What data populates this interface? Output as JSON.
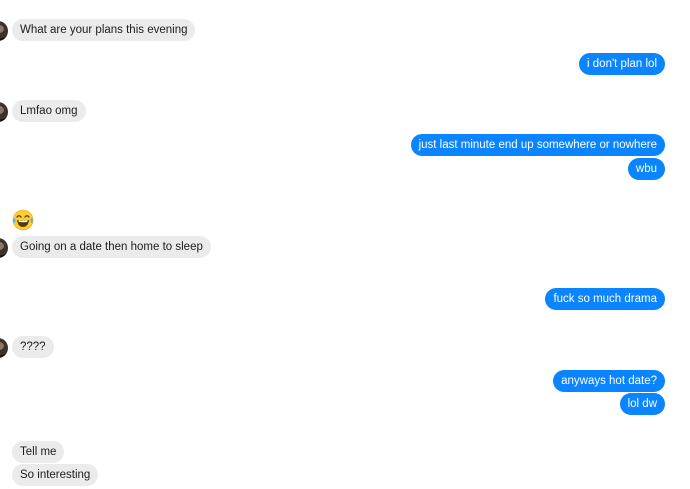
{
  "conversation": {
    "messages": [
      {
        "text": "What are your plans this evening"
      },
      {
        "text": "i don't plan lol"
      },
      {
        "text": "Lmfao omg"
      },
      {
        "text": "just last minute end up somewhere or nowhere"
      },
      {
        "text": "wbu"
      },
      {
        "text": "Going on a date then home to sleep"
      },
      {
        "text": "fuck so much drama"
      },
      {
        "text": "????"
      },
      {
        "text": "anyways hot date?"
      },
      {
        "text": "lol dw"
      },
      {
        "text": "Tell me"
      },
      {
        "text": "So interesting"
      }
    ],
    "emoji_name": "tears-of-joy-emoji",
    "colors": {
      "outgoing_bubble": "#0a84ff",
      "incoming_bubble": "#ebebeb",
      "incoming_text": "#1c1e21",
      "outgoing_text": "#ffffff"
    }
  }
}
